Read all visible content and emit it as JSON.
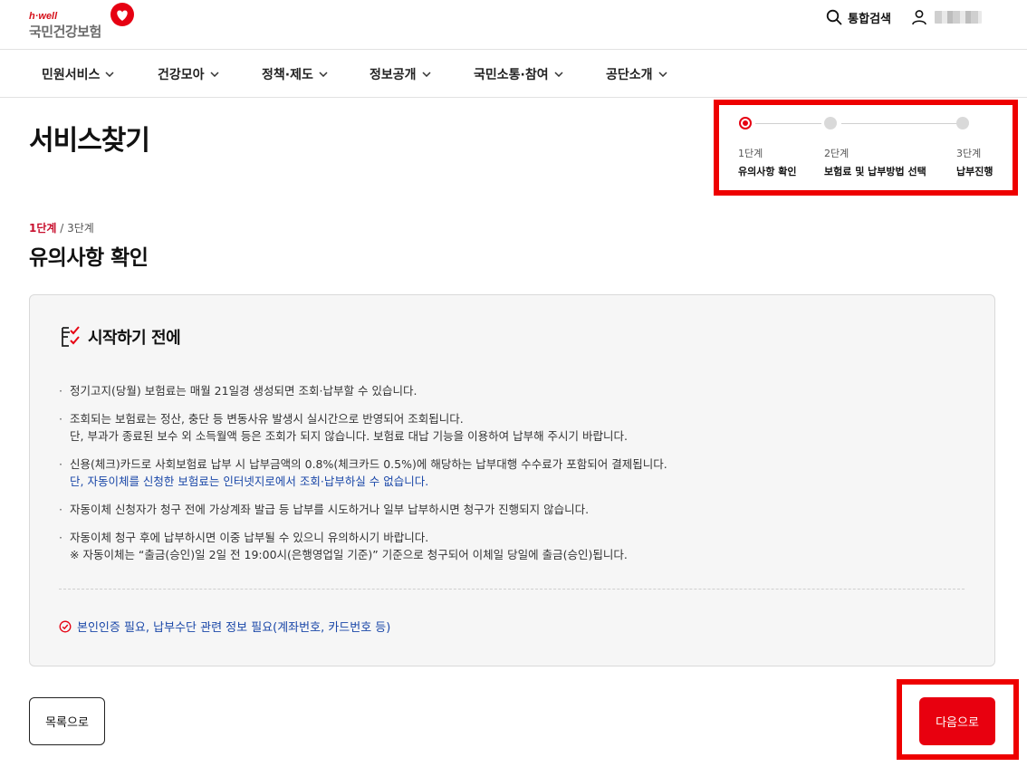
{
  "header": {
    "logo_sub": "h·well",
    "logo_main": "국민건강보험",
    "search_label": "통합검색"
  },
  "gnb": {
    "items": [
      {
        "label": "민원서비스"
      },
      {
        "label": "건강모아"
      },
      {
        "label": "정책·제도"
      },
      {
        "label": "정보공개"
      },
      {
        "label": "국민소통·참여"
      },
      {
        "label": "공단소개"
      }
    ]
  },
  "page": {
    "title": "서비스찾기"
  },
  "stepper": {
    "steps": [
      {
        "num": "1단계",
        "name": "유의사항 확인",
        "active": true
      },
      {
        "num": "2단계",
        "name": "보험료 및 납부방법 선택",
        "active": false
      },
      {
        "num": "3단계",
        "name": "납부진행",
        "active": false
      }
    ]
  },
  "step_indicator": {
    "current": "1단계",
    "separator": " / ",
    "total": "3단계"
  },
  "section": {
    "title": "유의사항 확인"
  },
  "notice": {
    "title": "시작하기 전에",
    "items": [
      {
        "line1": "정기고지(당월) 보험료는 매월 21일경 생성되면 조회·납부할 수 있습니다.",
        "line2": "",
        "line2_blue": false
      },
      {
        "line1": "조회되는 보험료는 정산, 충단 등 변동사유 발생시 실시간으로 반영되어 조회됩니다.",
        "line2": "단, 부과가 종료된 보수 외 소득월액 등은 조회가 되지 않습니다. 보험료 대납 기능을 이용하여 납부해 주시기 바랍니다.",
        "line2_blue": false
      },
      {
        "line1": "신용(체크)카드로 사회보험료 납부 시 납부금액의 0.8%(체크카드 0.5%)에 해당하는 납부대행 수수료가 포함되어 결제됩니다.",
        "line2": "단, 자동이체를 신청한 보험료는 인터넷지로에서 조회·납부하실 수 없습니다.",
        "line2_blue": true
      },
      {
        "line1": "자동이체 신청자가 청구 전에 가상계좌 발급 등 납부를 시도하거나 일부 납부하시면 청구가 진행되지 않습니다.",
        "line2": "",
        "line2_blue": false
      },
      {
        "line1": "자동이체 청구 후에 납부하시면 이중 납부될 수 있으니 유의하시기 바랍니다.",
        "line2": "※ 자동이체는 “출금(승인)일 2일 전 19:00시(은행영업일 기준)” 기준으로 청구되어 이체일 당일에 출금(승인)됩니다.",
        "line2_blue": false
      }
    ],
    "requirement": "본인인증 필요, 납부수단 관련 정보 필요(계좌번호, 카드번호 등)"
  },
  "buttons": {
    "list_label": "목록으로",
    "next_label": "다음으로"
  },
  "colors": {
    "brand_red": "#e60012",
    "link_blue": "#1a47a8",
    "highlight_frame": "#ee0000"
  }
}
